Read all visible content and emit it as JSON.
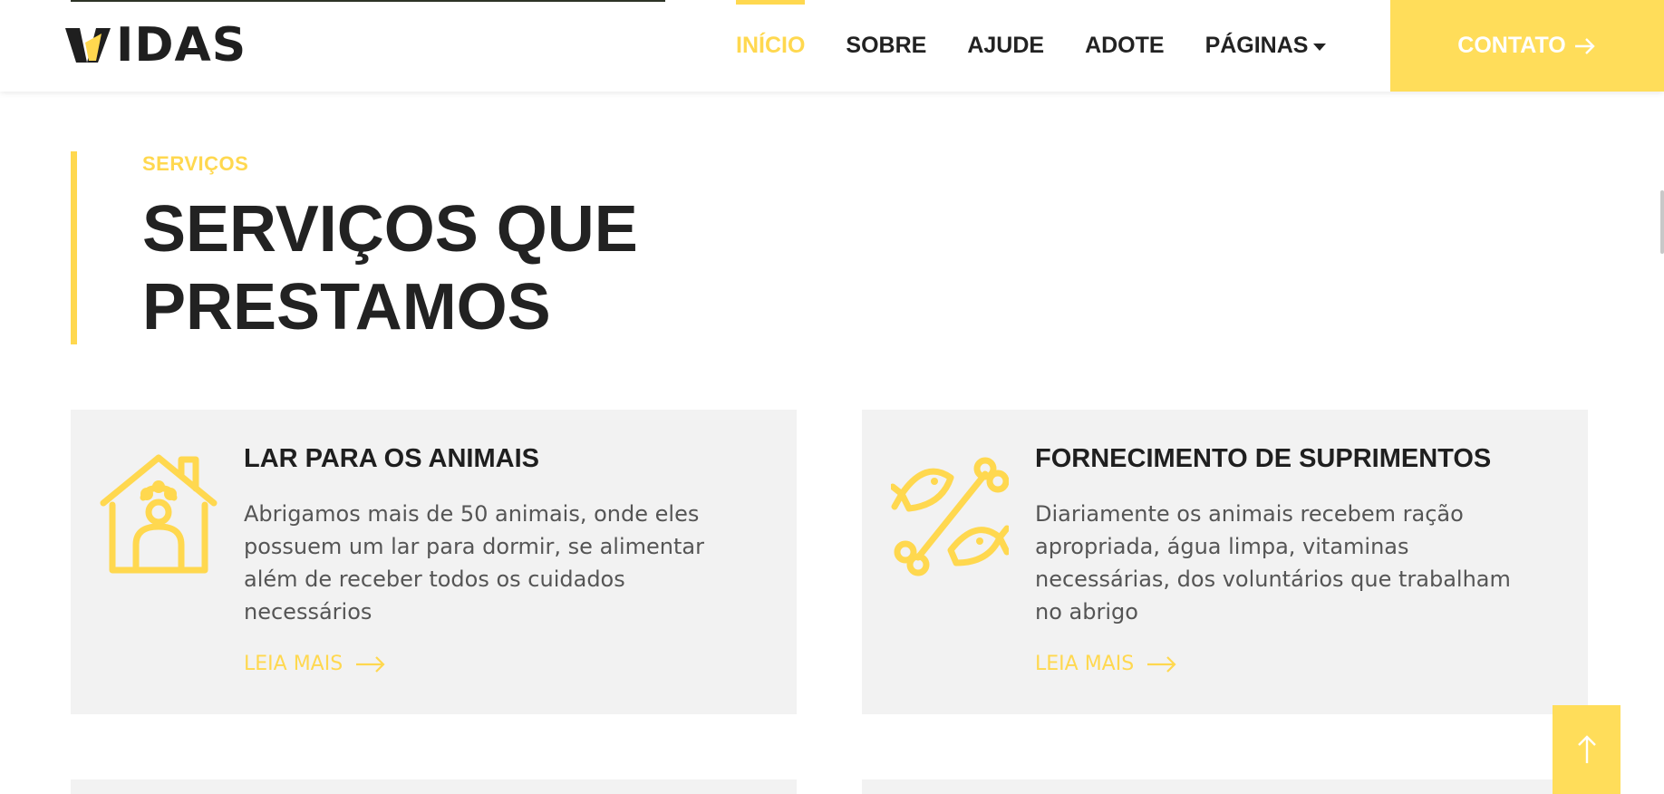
{
  "brand": {
    "logo_text": "IDAS",
    "accent": "#ffd84f"
  },
  "nav": {
    "items": [
      {
        "label": "INÍCIO"
      },
      {
        "label": "SOBRE"
      },
      {
        "label": "AJUDE"
      },
      {
        "label": "ADOTE"
      },
      {
        "label": "PÁGINAS"
      }
    ],
    "contact_label": "CONTATO"
  },
  "section": {
    "kicker": "SERVIÇOS",
    "title_line1": "SERVIÇOS QUE",
    "title_line2": "PRESTAMOS"
  },
  "cards": [
    {
      "icon": "dog-house-icon",
      "title": "LAR PARA OS ANIMAIS",
      "text": "Abrigamos mais de 50 animais, onde eles possuem um lar para dormir, se alimentar além de receber todos os cuidados necessários",
      "link": "LEIA MAIS"
    },
    {
      "icon": "fish-bone-icon",
      "title": "FORNECIMENTO DE SUPRIMENTOS",
      "text": "Diariamente os animais recebem ração apropriada, água limpa, vitaminas necessárias, dos voluntários que trabalham no abrigo",
      "link": "LEIA MAIS"
    }
  ]
}
